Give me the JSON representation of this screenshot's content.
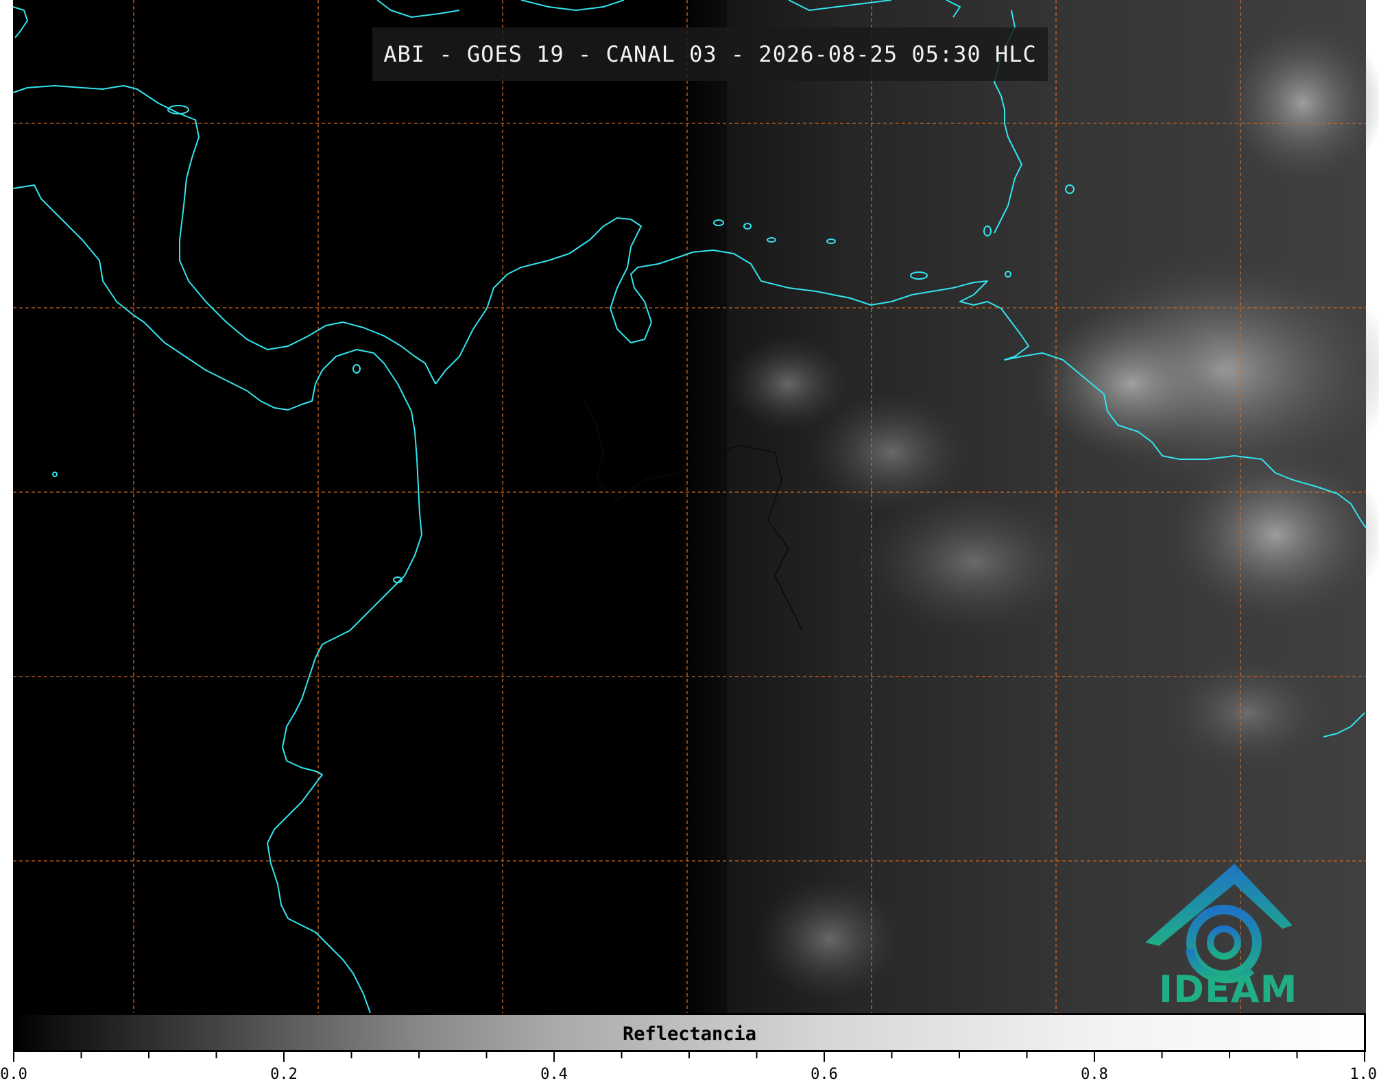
{
  "title": "ABI - GOES 19 - CANAL 03 - 2026-08-25 05:30 HLC",
  "colorbar": {
    "label": "Reflectancia",
    "ticks": [
      "0.0",
      "0.2",
      "0.4",
      "0.6",
      "0.8",
      "1.0"
    ],
    "range": [
      0.0,
      1.0
    ]
  },
  "logo": {
    "text": "IDEAM"
  },
  "colors": {
    "coastline": "#33e4ee",
    "gridline": "#d2691e",
    "night": "#000000",
    "logo_blue": "#1e74c4",
    "logo_green": "#1fae86"
  },
  "map": {
    "grid": true,
    "coastlines": true
  }
}
